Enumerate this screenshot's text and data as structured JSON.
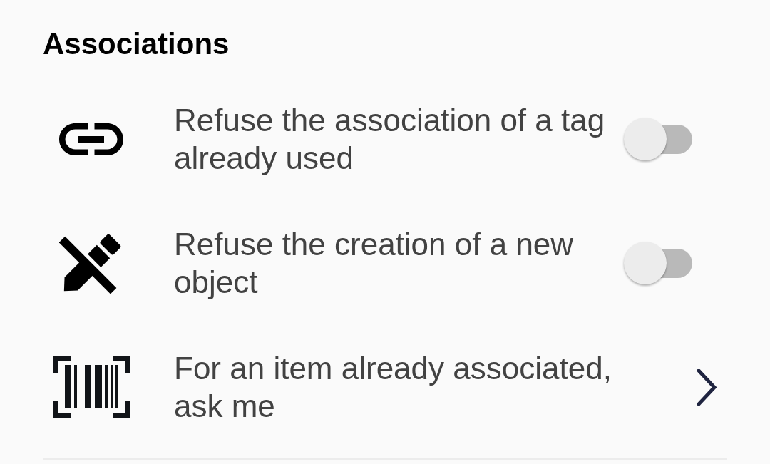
{
  "section": {
    "title": "Associations",
    "settings": [
      {
        "kind": "switch",
        "label": "Refuse the association of a tag already used",
        "on": false
      },
      {
        "kind": "switch",
        "label": "Refuse the creation of a new object",
        "on": false
      },
      {
        "kind": "link",
        "label": "For an item already associated, ask me"
      }
    ]
  }
}
